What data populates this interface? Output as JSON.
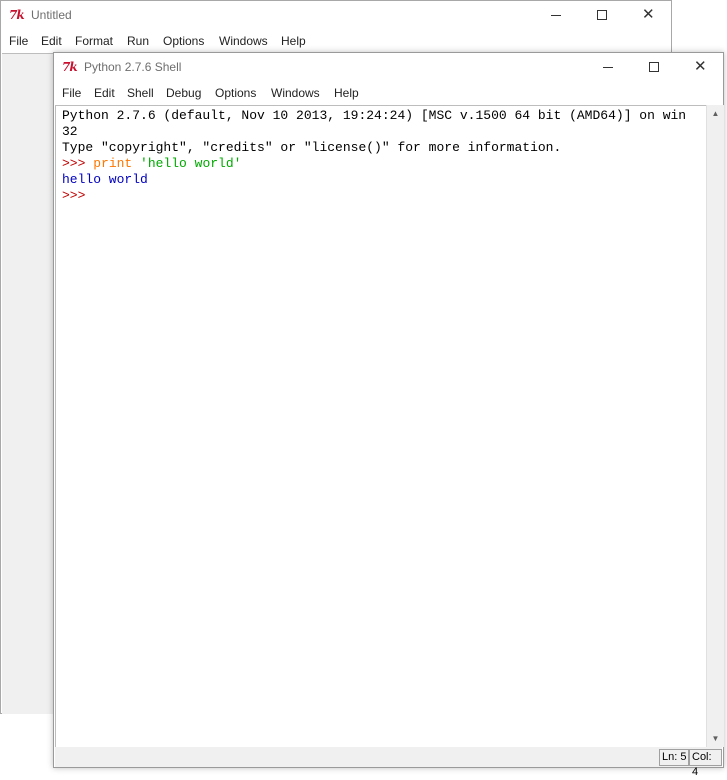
{
  "back_window": {
    "title": "Untitled",
    "menu": [
      "File",
      "Edit",
      "Format",
      "Run",
      "Options",
      "Windows",
      "Help"
    ],
    "logo_text": "7k"
  },
  "front_window": {
    "title": "Python 2.7.6 Shell",
    "logo_text": "7k",
    "menu": [
      "File",
      "Edit",
      "Shell",
      "Debug",
      "Options",
      "Windows",
      "Help"
    ],
    "shell_lines": {
      "banner_1": "Python 2.7.6 (default, Nov 10 2013, 19:24:24) [MSC v.1500 64 bit (AMD64)] on win",
      "banner_2": "32",
      "banner_3": "Type \"copyright\", \"credits\" or \"license()\" for more information.",
      "prompt_1": ">>> ",
      "cmd_keyword": "print",
      "cmd_space": " ",
      "cmd_string": "'hello world'",
      "output_1": "hello world",
      "prompt_2": ">>>"
    },
    "status": {
      "ln": "Ln: 5",
      "col": "Col: 4"
    }
  },
  "icons": {
    "minimize": "minimize-icon",
    "maximize": "maximize-icon",
    "close": "close-icon",
    "scroll_up": "scroll-up-arrow-icon",
    "scroll_down": "scroll-down-arrow-icon"
  },
  "colors": {
    "prompt": "#c00000",
    "keyword": "#ff7700",
    "string": "#00aa00",
    "stdout": "#0000c0",
    "tk_logo": "#c8102e"
  }
}
